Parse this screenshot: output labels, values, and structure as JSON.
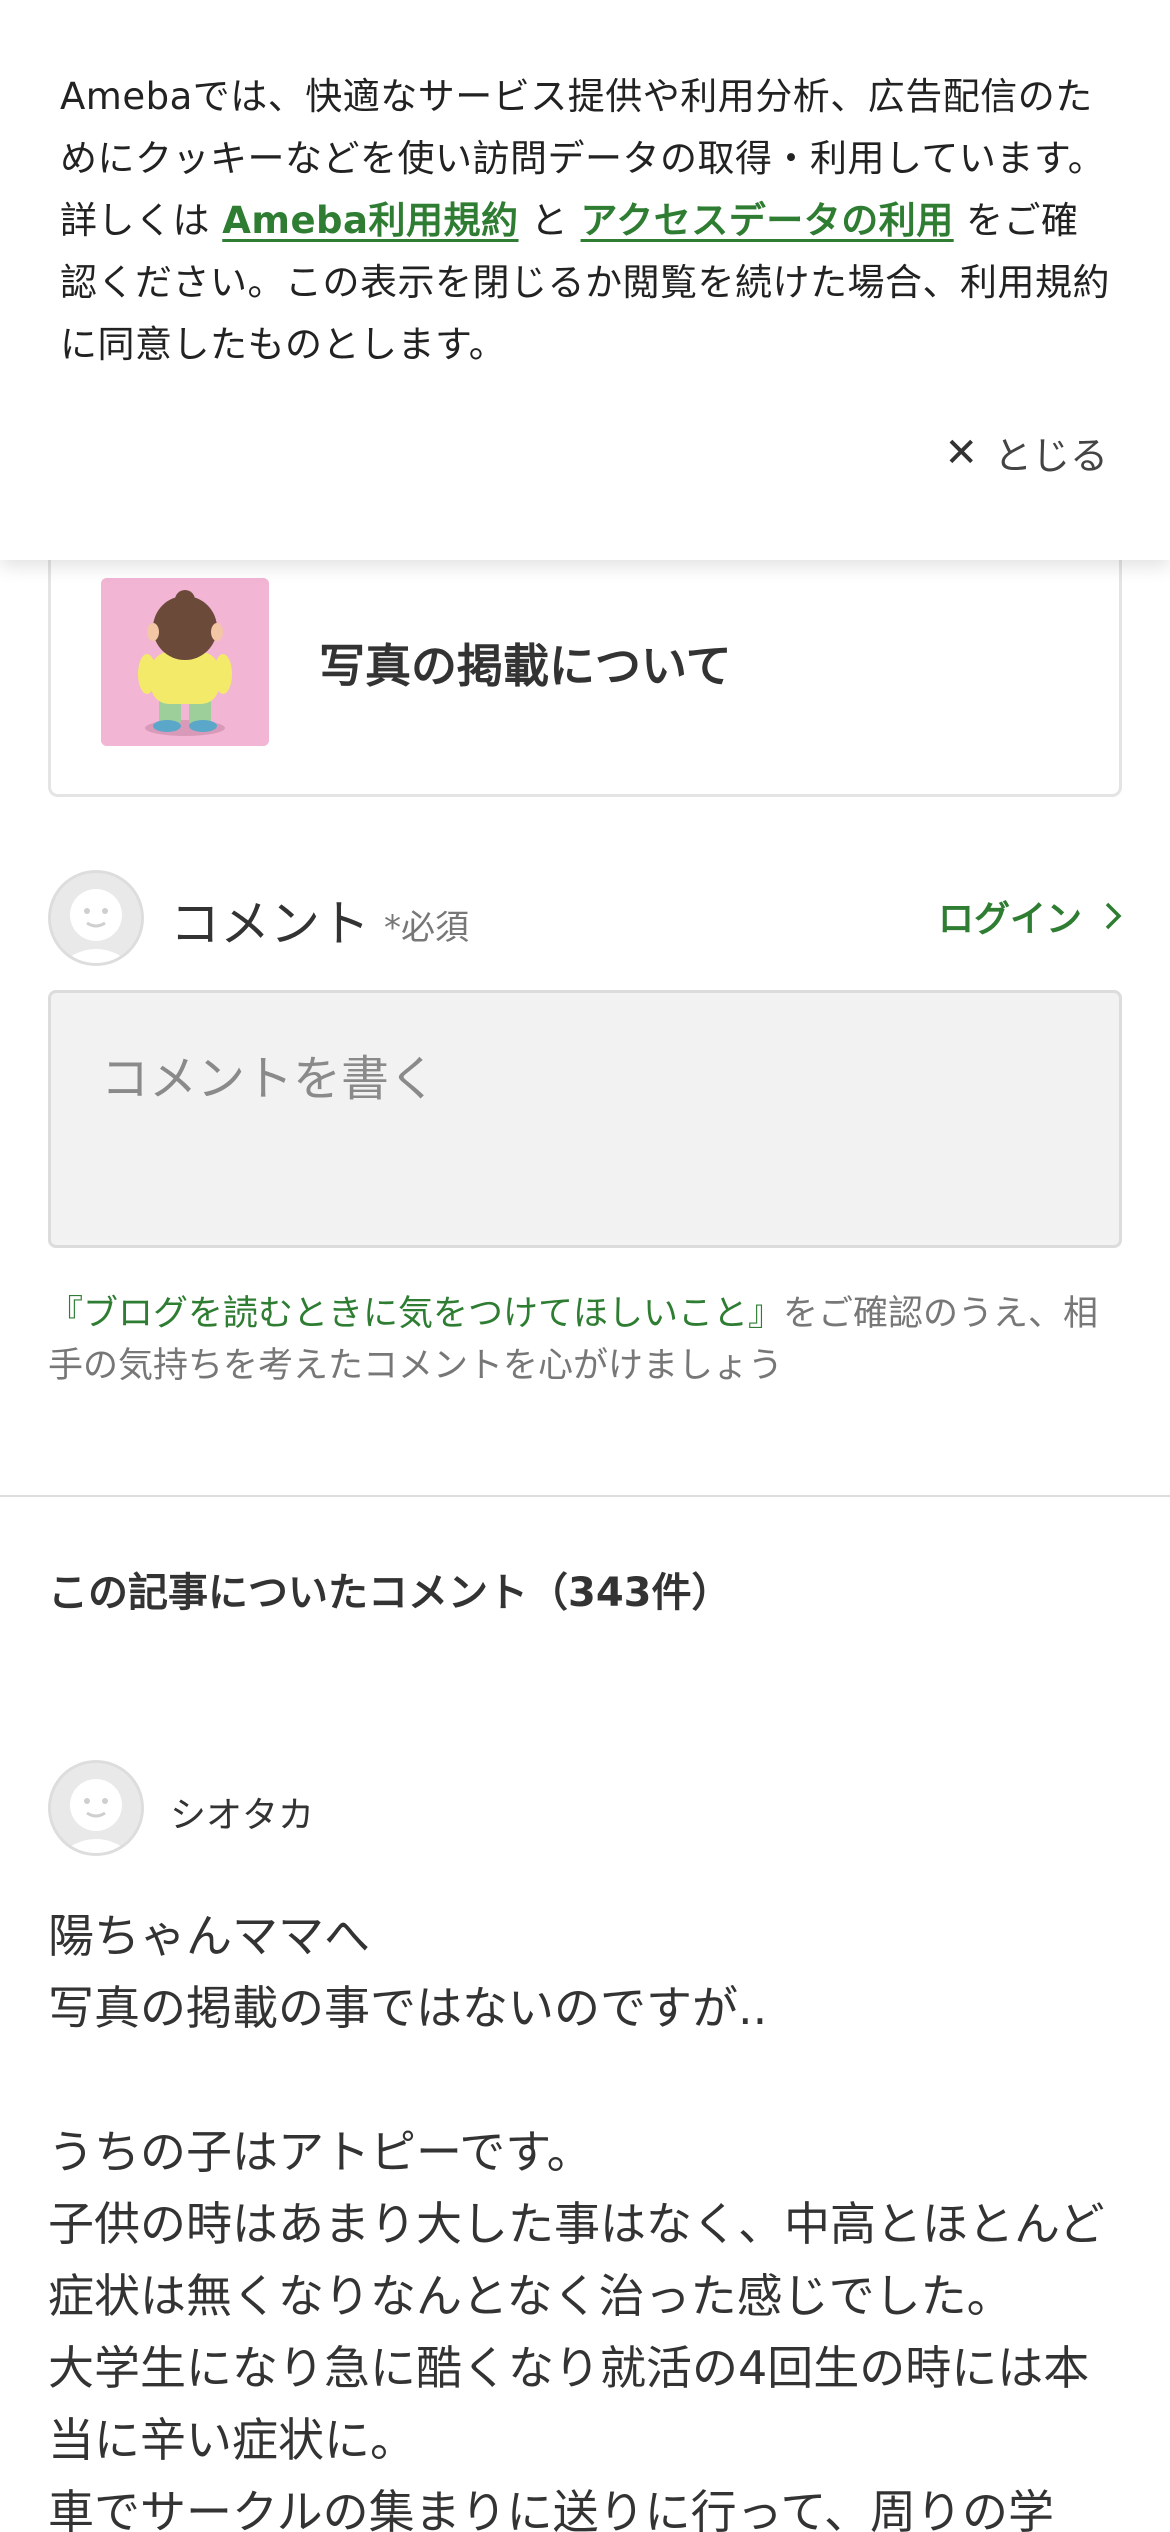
{
  "cookie_banner": {
    "text_before": "Amebaでは、快適なサービス提供や利用分析、広告配信のためにクッキーなどを使い訪問データの取得・利用しています。詳しくは ",
    "link_terms": "Ameba利用規約",
    "text_and": " と ",
    "link_access": "アクセスデータの利用",
    "text_after": " をご確認ください。この表示を閉じるか閲覧を続けた場合、利用規約に同意したものとします。",
    "close_label": "とじる",
    "close_icon": "close-icon"
  },
  "theme": {
    "title": "写真の掲載について"
  },
  "comment_form": {
    "label": "コメント",
    "required": "*必須",
    "login": "ログイン",
    "placeholder": "コメントを書く",
    "notice_link": "『ブログを読むときに気をつけてほしいこと』",
    "notice_text": "をご確認のうえ、相手の気持ちを考えたコメントを心がけましょう"
  },
  "comments": {
    "heading": "この記事についたコメント（343件）",
    "items": [
      {
        "name": "シオタカ",
        "body": "陽ちゃんママへ\n写真の掲載の事ではないのですが..\n\nうちの子はアトピーです。\n子供の時はあまり大した事はなく、中高とほとんど症状は無くなりなんとなく治った感じでした。\n大学生になり急に酷くなり就活の4回生の時には本当に辛い症状に。\n車でサークルの集まりに送りに行って、周りの学"
      }
    ]
  },
  "colors": {
    "accent_green": "#2e7d32",
    "text": "#333333",
    "muted": "#777777"
  }
}
